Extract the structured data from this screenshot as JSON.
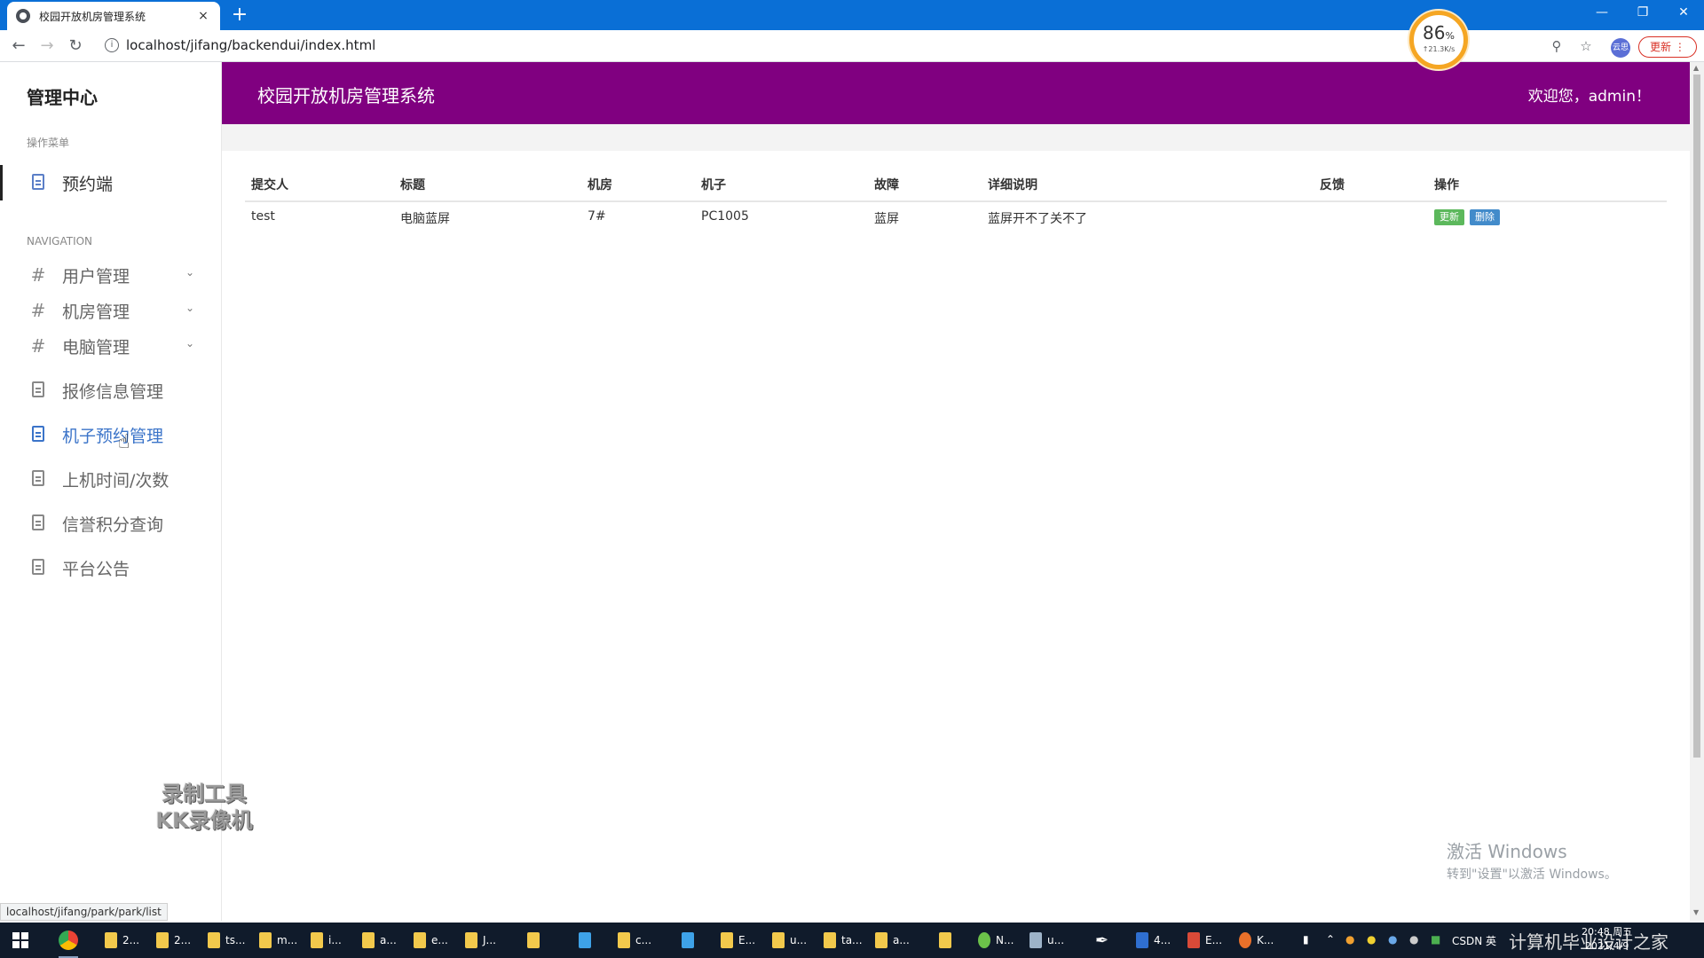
{
  "browser": {
    "tab_title": "校园开放机房管理系统",
    "tab_close": "×",
    "new_tab": "+",
    "url": "localhost/jifang/backendui/index.html",
    "profile_label": "云思",
    "update_label": "更新",
    "status_url": "localhost/jifang/park/park/list"
  },
  "speed_widget": {
    "percent": "86",
    "percent_sign": "%",
    "rate": "↑21.3K/s"
  },
  "sidebar": {
    "brand": "管理中心",
    "section_menu": "操作菜单",
    "active_item": "预约端",
    "section_nav": "NAVIGATION",
    "groups": [
      {
        "label": "用户管理"
      },
      {
        "label": "机房管理"
      },
      {
        "label": "电脑管理"
      }
    ],
    "items": [
      {
        "label": "报修信息管理"
      },
      {
        "label": "机子预约管理"
      },
      {
        "label": "上机时间/次数"
      },
      {
        "label": "信誉积分查询"
      },
      {
        "label": "平台公告"
      }
    ]
  },
  "header": {
    "title": "校园开放机房管理系统",
    "welcome": "欢迎您，admin！"
  },
  "table": {
    "columns": [
      "提交人",
      "标题",
      "机房",
      "机子",
      "故障",
      "详细说明",
      "反馈",
      "操作"
    ],
    "rows": [
      {
        "submitter": "test",
        "title": "电脑蓝屏",
        "room": "7#",
        "machine": "PC1005",
        "fault": "蓝屏",
        "detail": "蓝屏开不了关不了",
        "feedback": ""
      }
    ],
    "update_btn": "更新",
    "delete_btn": "删除"
  },
  "watermark": {
    "line1": "录制工具",
    "line2": "KK录像机"
  },
  "activate": {
    "line1": "激活 Windows",
    "line2": "转到\"设置\"以激活 Windows。"
  },
  "taskbar": {
    "items": [
      "2...",
      "2...",
      "ts...",
      "m...",
      "i...",
      "a...",
      "e...",
      "J...",
      "",
      "c...",
      "",
      "E...",
      "u...",
      "ta...",
      "a...",
      "",
      "N...",
      "u...",
      "",
      "4...",
      "E...",
      "K..."
    ],
    "tray_text": "CSDN 英",
    "clock_time": "20:48 周五",
    "clock_date": "2021/4/9",
    "overlay": "计算机毕业设计之家"
  },
  "colors": {
    "header_bg": "#800080",
    "tab_bg": "#0a6fd6",
    "update_btn": "#5cb85c",
    "delete_btn": "#428bca",
    "highlight": "#3b74c9"
  }
}
